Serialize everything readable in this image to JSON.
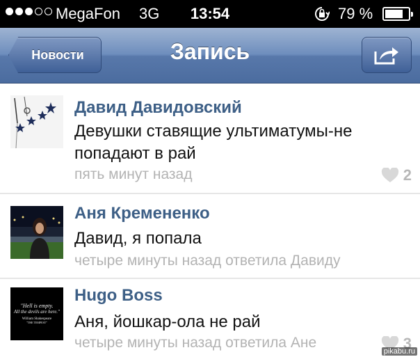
{
  "status_bar": {
    "carrier": "MegaFon",
    "network": "3G",
    "time": "13:54",
    "battery": "79 %",
    "battery_level": 0.79
  },
  "nav": {
    "back_label": "Новости",
    "title": "Запись",
    "share_icon": "share-icon"
  },
  "posts": [
    {
      "name": "Давид Давидовский",
      "text": "Девушки ставящие ультиматумы-не попадают в рай",
      "meta": "пять минут назад",
      "likes": "2"
    },
    {
      "name": "Аня Крemenенко",
      "text": "Давид, я попала",
      "meta": "четыре минуты назад ответила Давиду",
      "likes": ""
    },
    {
      "name": "Hugo Boss",
      "text": "Аня, йошкар-ола не рай",
      "meta": "четыре минуты назад ответила Ане",
      "likes": "3",
      "avatar_text": [
        "\"Hell is empty.",
        "All the devils are here.\"",
        "William Shakespeare",
        "\"THE TEMPEST\""
      ]
    }
  ],
  "watermark": "pikabu.ru"
}
